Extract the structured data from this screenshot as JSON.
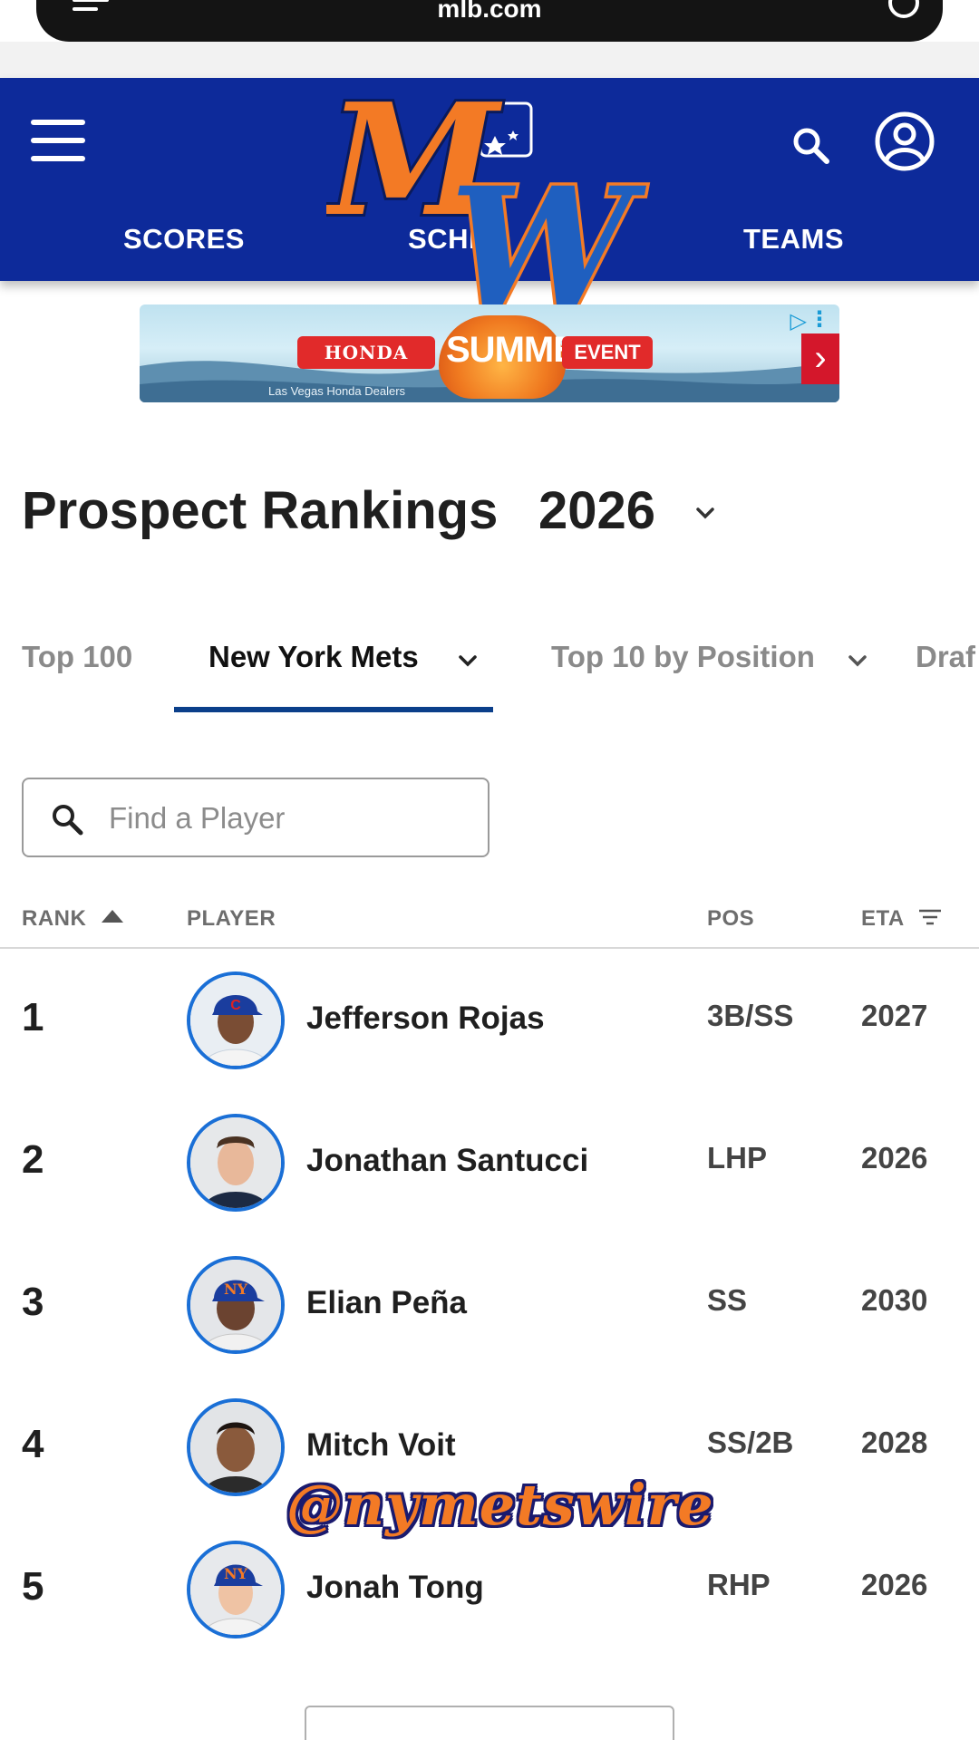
{
  "browser": {
    "url": "mlb.com",
    "menu_icon": "menu-lines-icon",
    "reload_icon": "reload-icon"
  },
  "header": {
    "bg_color": "#0d2a9a",
    "logo_text": "MW",
    "nav": [
      {
        "label": "SCORES"
      },
      {
        "label": "SCHE"
      },
      {
        "label": "TEAMS"
      }
    ],
    "icons": {
      "menu": "hamburger-icon",
      "search": "search-icon",
      "profile": "profile-icon"
    }
  },
  "ad": {
    "brand": "HONDA",
    "headline": "SUMMER",
    "event": "EVENT",
    "dealers": "Las Vegas Honda Dealers"
  },
  "page": {
    "title": "Prospect Rankings",
    "year": "2026"
  },
  "tabs": [
    {
      "label": "Top 100",
      "active": false
    },
    {
      "label": "New York Mets",
      "active": true
    },
    {
      "label": "Top 10 by Position",
      "active": false
    },
    {
      "label": "Draf",
      "active": false
    }
  ],
  "search": {
    "placeholder": "Find a Player",
    "value": ""
  },
  "table": {
    "columns": {
      "rank": "RANK",
      "player": "PLAYER",
      "pos": "POS",
      "eta": "ETA"
    },
    "rows": [
      {
        "rank": "1",
        "name": "Jefferson Rojas",
        "pos": "3B/SS",
        "eta": "2027",
        "cap": "cubs"
      },
      {
        "rank": "2",
        "name": "Jonathan Santucci",
        "pos": "LHP",
        "eta": "2026",
        "cap": "none"
      },
      {
        "rank": "3",
        "name": "Elian Peña",
        "pos": "SS",
        "eta": "2030",
        "cap": "mets"
      },
      {
        "rank": "4",
        "name": "Mitch Voit",
        "pos": "SS/2B",
        "eta": "2028",
        "cap": "none"
      },
      {
        "rank": "5",
        "name": "Jonah Tong",
        "pos": "RHP",
        "eta": "2026",
        "cap": "mets"
      }
    ]
  },
  "watermark": "@nymetswire",
  "colors": {
    "accent": "#0b3f8a",
    "avatar_ring": "#1a6fd6",
    "watermark": "#f37a25"
  }
}
